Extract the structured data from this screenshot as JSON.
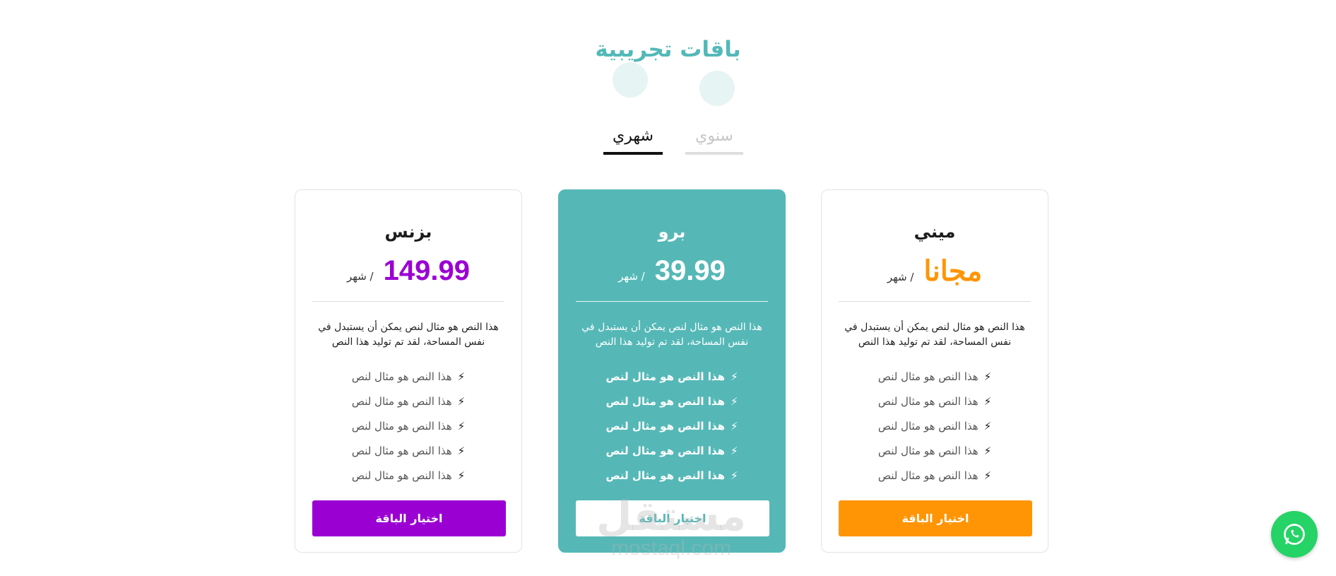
{
  "section": {
    "title": "باقات تجريبية"
  },
  "tabs": [
    {
      "label": "شهري",
      "active": true
    },
    {
      "label": "سنوي",
      "active": false
    }
  ],
  "plans": [
    {
      "name": "بزنس",
      "price": "149.99",
      "period": "/ شهر",
      "accent": "#9b00d3",
      "description": "هذا النص هو مثال لنص يمكن أن يستبدل في نفس المساحة، لقد تم توليد هذا النص",
      "features": [
        "هذا النص هو مثال لنص",
        "هذا النص هو مثال لنص",
        "هذا النص هو مثال لنص",
        "هذا النص هو مثال لنص",
        "هذا النص هو مثال لنص"
      ],
      "cta": "اختيار الباقة"
    },
    {
      "name": "برو",
      "price": "39.99",
      "period": "/ شهر",
      "accent": "#55b8b7",
      "description": "هذا النص هو مثال لنص يمكن أن يستبدل في نفس المساحة، لقد تم توليد هذا النص",
      "features": [
        "هذا النص هو مثال لنص",
        "هذا النص هو مثال لنص",
        "هذا النص هو مثال لنص",
        "هذا النص هو مثال لنص",
        "هذا النص هو مثال لنص"
      ],
      "cta": "اختيار الباقة"
    },
    {
      "name": "ميني",
      "price": "مجانا",
      "period": "/ شهر",
      "accent": "#ff9505",
      "description": "هذا النص هو مثال لنص يمكن أن يستبدل في نفس المساحة، لقد تم توليد هذا النص",
      "features": [
        "هذا النص هو مثال لنص",
        "هذا النص هو مثال لنص",
        "هذا النص هو مثال لنص",
        "هذا النص هو مثال لنص",
        "هذا النص هو مثال لنص"
      ],
      "cta": "اختيار الباقة"
    }
  ],
  "feature_icon": "lightning-bolt-icon",
  "watermark": {
    "arabic": "مستقل",
    "latin": "mostaql.com"
  },
  "chat_button_icon": "whatsapp-icon",
  "colors": {
    "teal": "#55b8b7",
    "purple": "#9b00d3",
    "orange": "#ff9505",
    "whatsapp": "#25d366"
  }
}
